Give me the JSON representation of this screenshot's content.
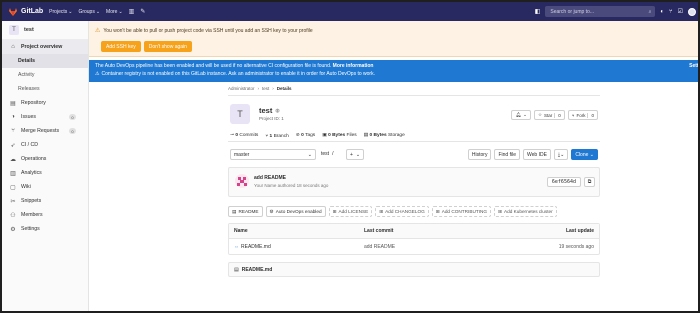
{
  "navbar": {
    "brand": "GitLab",
    "projects": "Projects",
    "groups": "Groups",
    "more": "More",
    "search_placeholder": "Search or jump to..."
  },
  "sidebar": {
    "project_initial": "T",
    "project_name": "test",
    "overview": "Project overview",
    "overview_sub": [
      "Details",
      "Activity",
      "Releases"
    ],
    "items": [
      {
        "label": "Repository",
        "icon": "book-icon"
      },
      {
        "label": "Issues",
        "icon": "issues-icon",
        "count": "0"
      },
      {
        "label": "Merge Requests",
        "icon": "merge-request-icon",
        "count": "0"
      },
      {
        "label": "CI / CD",
        "icon": "rocket-icon"
      },
      {
        "label": "Operations",
        "icon": "cloud-icon"
      },
      {
        "label": "Analytics",
        "icon": "chart-icon"
      },
      {
        "label": "Wiki",
        "icon": "wiki-icon"
      },
      {
        "label": "Snippets",
        "icon": "scissors-icon"
      },
      {
        "label": "Members",
        "icon": "users-icon"
      },
      {
        "label": "Settings",
        "icon": "gear-icon"
      }
    ]
  },
  "alerts": {
    "ssh_message": "You won't be able to pull or push project code via SSH until you add an SSH key to your profile",
    "add_ssh_key": "Add SSH key",
    "dont_show": "Don't show again",
    "devops_text": "The Auto DevOps pipeline has been enabled and will be used if no alternative CI configuration file is found.",
    "devops_link": "More information",
    "registry_text": "Container registry is not enabled on this GitLab instance. Ask an administrator to enable it in order for Auto DevOps to work.",
    "settings_link": "Setti"
  },
  "breadcrumb": [
    "Administrator",
    "test",
    "Details"
  ],
  "project": {
    "initial": "T",
    "name": "test",
    "id_text": "Project ID: 1",
    "star_label": "Star",
    "star_count": "0",
    "fork_label": "Fork",
    "fork_count": "0"
  },
  "stats": {
    "commits_num": "0",
    "commits_label": "Commits",
    "branch_num": "1",
    "branch_label": "Branch",
    "tags_num": "0",
    "tags_label": "Tags",
    "files_size": "0 Bytes",
    "files_label": "Files",
    "storage_size": "0 Bytes",
    "storage_label": "Storage"
  },
  "toolbar": {
    "branch": "master",
    "path": "test",
    "add": "+",
    "history": "History",
    "find_file": "Find file",
    "web_ide": "Web IDE",
    "clone": "Clone"
  },
  "commit": {
    "title": "add README",
    "subtitle": "Your Name authored 18 seconds ago",
    "sha": "6ef6564d"
  },
  "shortcuts": [
    {
      "label": "README",
      "style": "solid",
      "icon": "document-icon"
    },
    {
      "label": "Auto DevOps enabled",
      "style": "solid",
      "icon": "gear-icon"
    },
    {
      "label": "Add LICENSE",
      "style": "dashed",
      "icon": "plus-icon"
    },
    {
      "label": "Add CHANGELOG",
      "style": "dashed",
      "icon": "plus-icon"
    },
    {
      "label": "Add CONTRIBUTING",
      "style": "dashed",
      "icon": "plus-icon"
    },
    {
      "label": "Add Kubernetes cluster",
      "style": "dashed",
      "icon": "plus-icon"
    }
  ],
  "files_table": {
    "headers": [
      "Name",
      "Last commit",
      "Last update"
    ],
    "rows": [
      {
        "name": "README.md",
        "commit": "add README",
        "updated": "19 seconds ago"
      }
    ]
  },
  "readme_box": "README.md",
  "colors": {
    "navbar": "#292961",
    "warning_bg": "#fdf2e3",
    "warning_button": "#f6a21b",
    "info_bg": "#1f78d1",
    "primary_button": "#1f78d1"
  }
}
